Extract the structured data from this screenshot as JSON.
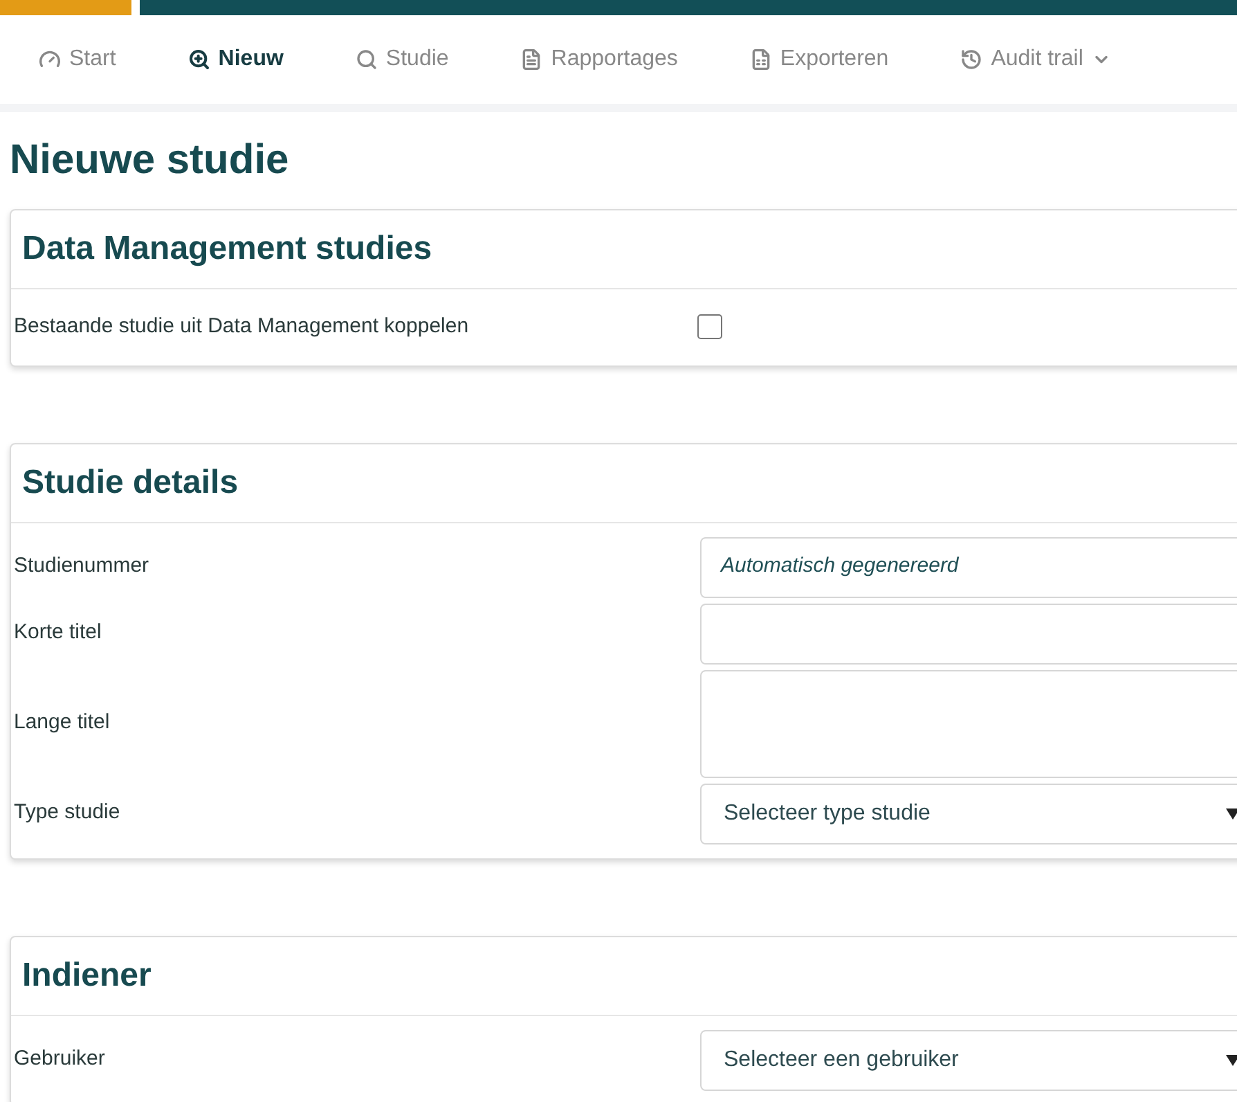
{
  "nav": [
    {
      "label": "Start",
      "selected": false
    },
    {
      "label": "Nieuw",
      "selected": true
    },
    {
      "label": "Studie",
      "selected": false
    },
    {
      "label": "Rapportages",
      "selected": false
    },
    {
      "label": "Exporteren",
      "selected": false
    },
    {
      "label": "Audit trail",
      "selected": false,
      "dropdown": true
    }
  ],
  "page_title": "Nieuwe studie",
  "sections": [
    {
      "title": "Data Management studies",
      "fields": [
        {
          "kind": "checkbox",
          "label": "Bestaande studie uit Data Management koppelen",
          "checked": false
        }
      ]
    },
    {
      "title": "Studie details",
      "fields": [
        {
          "kind": "input",
          "label": "Studienummer",
          "placeholder": "Automatisch gegenereerd"
        },
        {
          "kind": "input",
          "label": "Korte titel"
        },
        {
          "kind": "textarea",
          "label": "Lange titel"
        },
        {
          "kind": "select",
          "label": "Type studie",
          "value": "Selecteer type studie"
        }
      ]
    },
    {
      "title": "Indiener",
      "fields": [
        {
          "kind": "select",
          "label": "Gebruiker",
          "value": "Selecteer een gebruiker"
        }
      ]
    }
  ]
}
